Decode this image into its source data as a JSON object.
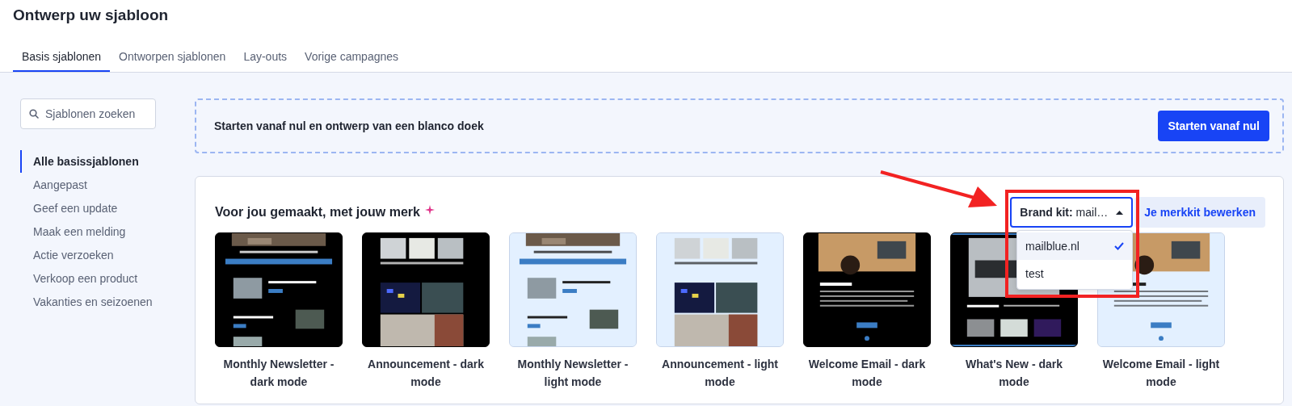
{
  "page_title": "Ontwerp uw sjabloon",
  "tabs": [
    {
      "label": "Basis sjablonen",
      "selected": true
    },
    {
      "label": "Ontworpen sjablonen",
      "selected": false
    },
    {
      "label": "Lay-outs",
      "selected": false
    },
    {
      "label": "Vorige campagnes",
      "selected": false
    }
  ],
  "search": {
    "placeholder": "Sjablonen zoeken"
  },
  "categories": [
    {
      "label": "Alle basissjablonen",
      "selected": true
    },
    {
      "label": "Aangepast",
      "selected": false
    },
    {
      "label": "Geef een update",
      "selected": false
    },
    {
      "label": "Maak een melding",
      "selected": false
    },
    {
      "label": "Actie verzoeken",
      "selected": false
    },
    {
      "label": "Verkoop een product",
      "selected": false
    },
    {
      "label": "Vakanties en seizoenen",
      "selected": false
    }
  ],
  "blank_start": {
    "text": "Starten vanaf nul en ontwerp van een blanco doek",
    "button": "Starten vanaf nul"
  },
  "brand_section": {
    "heading": "Voor jou gemaakt, met jouw merk",
    "brand_kit": {
      "label": "Brand kit:",
      "value": "mail…",
      "expanded": true,
      "options": [
        {
          "label": "mailblue.nl",
          "selected": true
        },
        {
          "label": "test",
          "selected": false
        }
      ]
    },
    "edit_button": "Je merkkit bewerken",
    "templates": [
      {
        "name": "Monthly Newsletter - dark mode"
      },
      {
        "name": "Announcement - dark mode"
      },
      {
        "name": "Monthly Newsletter - light mode"
      },
      {
        "name": "Announcement - light mode"
      },
      {
        "name": "Welcome Email - dark mode"
      },
      {
        "name": "What's New - dark mode"
      },
      {
        "name": "Welcome Email - light mode"
      }
    ]
  }
}
